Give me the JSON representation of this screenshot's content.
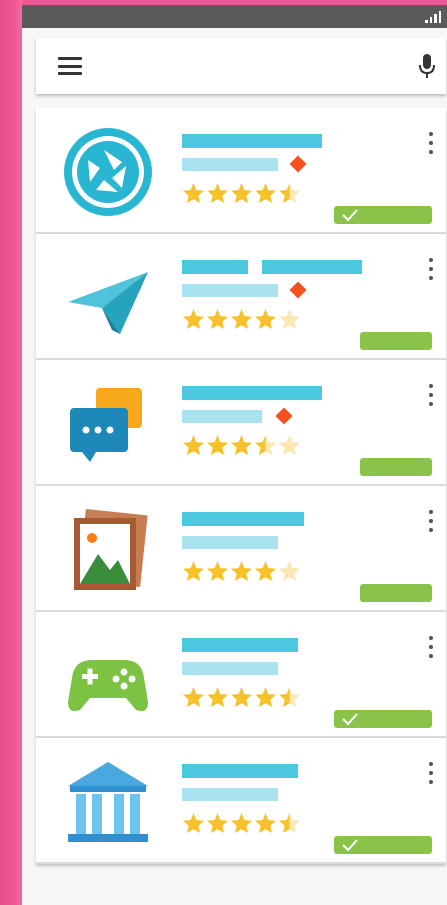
{
  "colors": {
    "accent_pink": "#e94d8b",
    "title_bar": "#4bc8e0",
    "subtitle_bar": "#a9e3ef",
    "star": "#f8c12a",
    "star_empty": "#fbe7b4",
    "badge": "#f4511e",
    "button": "#8bc34a"
  },
  "toolbar": {
    "menu_icon": "menu-icon",
    "mic_icon": "mic-icon"
  },
  "apps": [
    {
      "icon": "camera-aperture-icon",
      "rating": 4.5,
      "badge": true,
      "installed": true
    },
    {
      "icon": "paper-plane-icon",
      "rating": 4.0,
      "badge": true,
      "installed": false
    },
    {
      "icon": "chat-bubbles-icon",
      "rating": 3.5,
      "badge": true,
      "installed": false
    },
    {
      "icon": "photo-gallery-icon",
      "rating": 4.0,
      "badge": false,
      "installed": false
    },
    {
      "icon": "gamepad-icon",
      "rating": 4.5,
      "badge": false,
      "installed": true
    },
    {
      "icon": "bank-building-icon",
      "rating": 4.5,
      "badge": false,
      "installed": true
    }
  ]
}
